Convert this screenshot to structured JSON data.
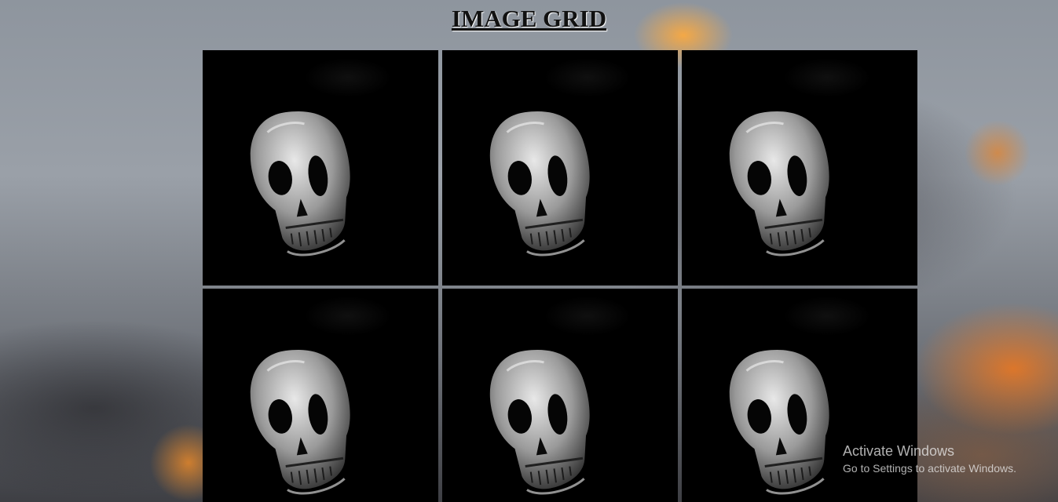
{
  "page": {
    "title": "IMAGE GRID"
  },
  "grid": {
    "images": [
      {
        "subject": "skull-image"
      },
      {
        "subject": "skull-image"
      },
      {
        "subject": "skull-image"
      },
      {
        "subject": "skull-image"
      },
      {
        "subject": "skull-image"
      },
      {
        "subject": "skull-image"
      }
    ]
  },
  "watermark": {
    "title": "Activate Windows",
    "subtitle": "Go to Settings to activate Windows."
  },
  "colors": {
    "cell_background": "#000000",
    "title_color": "#111111"
  }
}
